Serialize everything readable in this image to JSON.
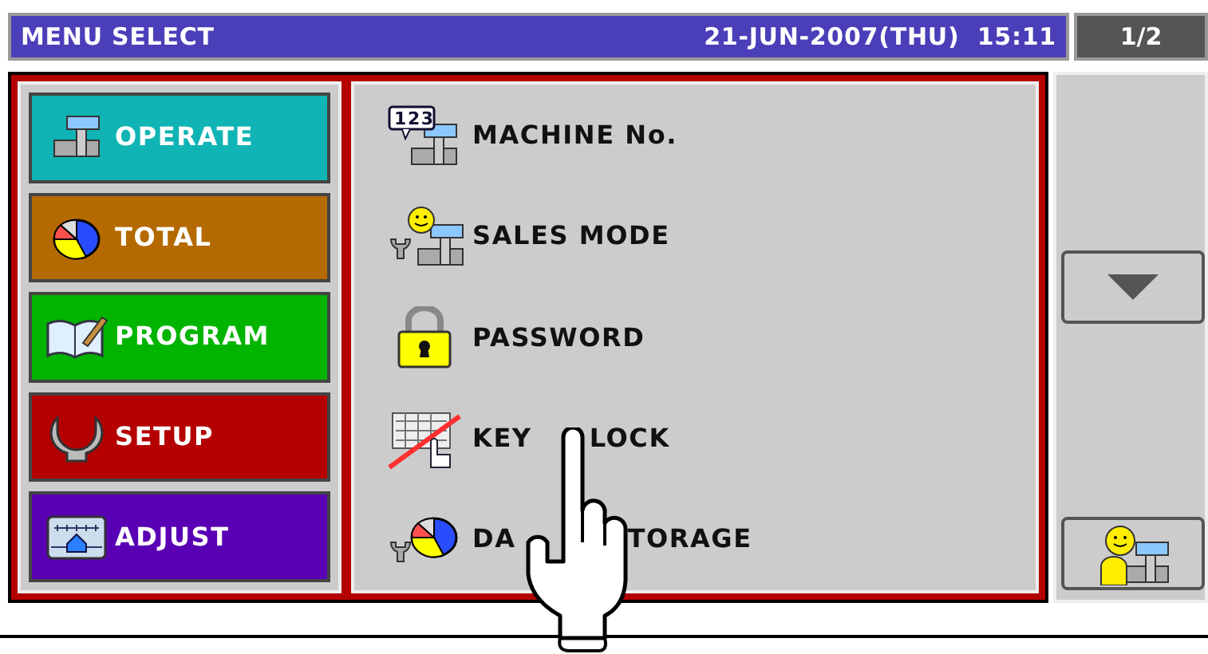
{
  "title_bar": {
    "title": "MENU SELECT",
    "datetime": "21-JUN-2007(THU)  15:11",
    "page": "1/2"
  },
  "categories": [
    {
      "label": "OPERATE",
      "kind": "operate",
      "color": "#10b4b4"
    },
    {
      "label": "TOTAL",
      "kind": "total",
      "color": "#b46a00"
    },
    {
      "label": "PROGRAM",
      "kind": "program",
      "color": "#00b400"
    },
    {
      "label": "SETUP",
      "kind": "setup",
      "color": "#b40000"
    },
    {
      "label": "ADJUST",
      "kind": "adjust",
      "color": "#5a00b4"
    }
  ],
  "menu_items": [
    {
      "label_parts": [
        "MACHINE No."
      ],
      "kind": "machine",
      "icon_text": "123"
    },
    {
      "label_parts": [
        "SALES MODE"
      ],
      "kind": "sales"
    },
    {
      "label_parts": [
        "PASSWORD"
      ],
      "kind": "password"
    },
    {
      "label_parts": [
        "KEY",
        "LOCK"
      ],
      "kind": "keylock"
    },
    {
      "label_parts": [
        "DA",
        "TORAGE"
      ],
      "kind": "storage"
    }
  ]
}
